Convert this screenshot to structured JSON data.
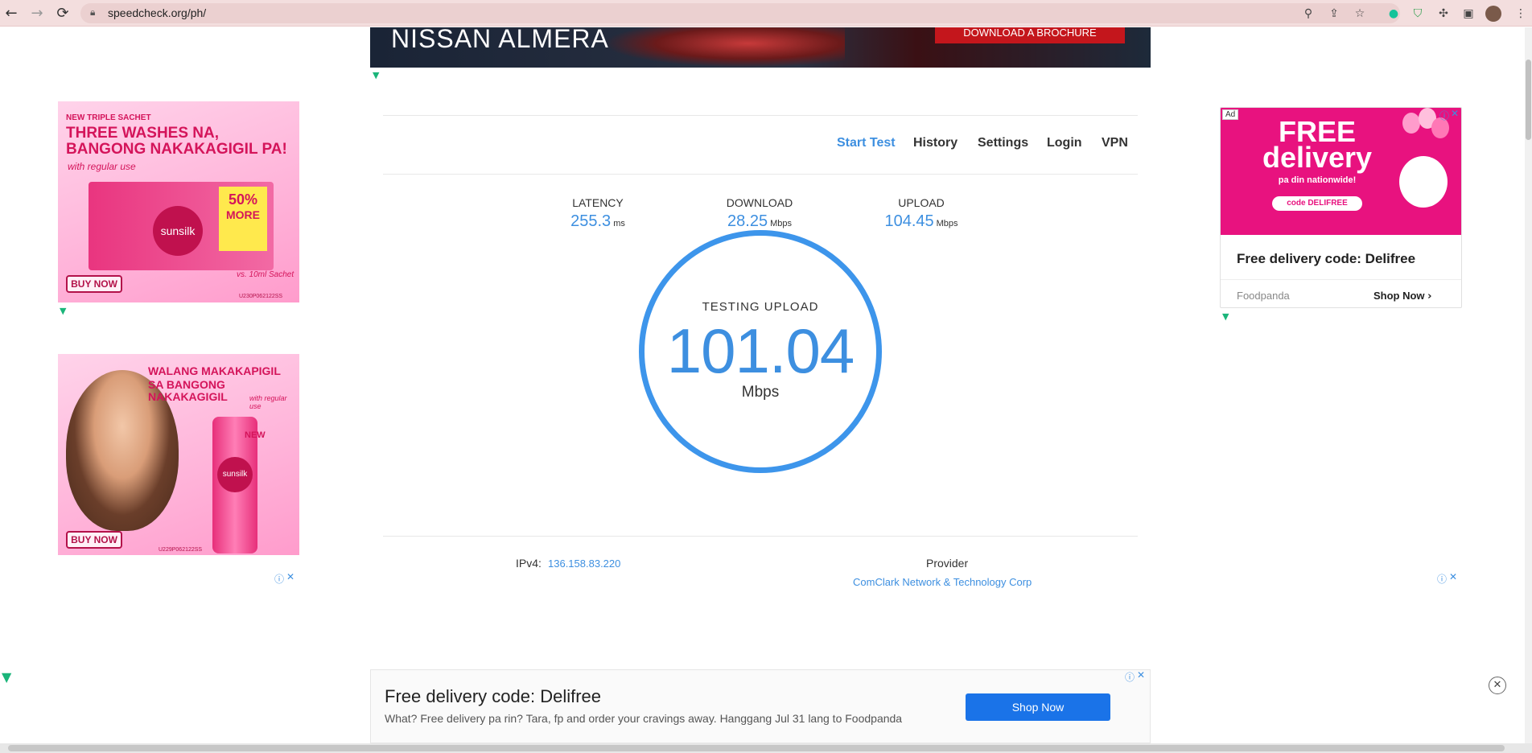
{
  "browser": {
    "url": "speedcheck.org/ph/",
    "back_icon": "←",
    "forward_icon": "→",
    "reload_icon": "⟳"
  },
  "top_banner": {
    "title": "NISSAN ALMERA",
    "cta": "DOWNLOAD A BROCHURE"
  },
  "left_ad_1": {
    "tagline": "NEW TRIPLE SACHET",
    "headline_1": "THREE WASHES NA,",
    "headline_2": "BANGONG NAKAKAGIGIL PA!",
    "sub": "with regular use",
    "brand": "sunsilk",
    "badge_pct": "50%",
    "badge_more": "MORE",
    "compare": "vs. 10ml Sachet",
    "buy": "BUY NOW",
    "code": "U230P062122SS"
  },
  "left_ad_2": {
    "headline_1": "WALANG MAKAKAPIGIL",
    "headline_2": "SA BANGONG NAKAKAGIGIL",
    "sub": "with regular use",
    "badge": "NEW",
    "brand": "sunsilk",
    "buy": "BUY NOW",
    "code": "U229P062122SS"
  },
  "nav": {
    "start_test": "Start Test",
    "history": "History",
    "settings": "Settings",
    "login": "Login",
    "vpn": "VPN"
  },
  "metrics": {
    "latency": {
      "label": "LATENCY",
      "value": "255.3",
      "unit": "ms"
    },
    "download": {
      "label": "DOWNLOAD",
      "value": "28.25",
      "unit": "Mbps"
    },
    "upload": {
      "label": "UPLOAD",
      "value": "104.45",
      "unit": "Mbps"
    }
  },
  "gauge": {
    "status": "TESTING UPLOAD",
    "value": "101.04",
    "unit": "Mbps"
  },
  "info": {
    "ipv4_label": "IPv4:",
    "ipv4_value": "136.158.83.220",
    "provider_label": "Provider",
    "provider_value": "ComClark Network & Technology Corp"
  },
  "right_ad": {
    "ad_tag": "Ad",
    "free": "FREE",
    "delivery": "delivery",
    "sub": "pa din nationwide!",
    "code": "code DELIFREE",
    "title": "Free delivery code: Delifree",
    "brand": "Foodpanda",
    "cta": "Shop Now"
  },
  "bottom_ad": {
    "title": "Free delivery code: Delifree",
    "desc": "What? Free delivery pa rin? Tara, fp and order your cravings away. Hanggang Jul 31 lang to Foodpanda",
    "cta": "Shop Now"
  },
  "colors": {
    "accent": "#3d8fe0",
    "chrome": "#f3dede",
    "foodpanda": "#e8127f",
    "sunsilk": "#d4145a"
  }
}
